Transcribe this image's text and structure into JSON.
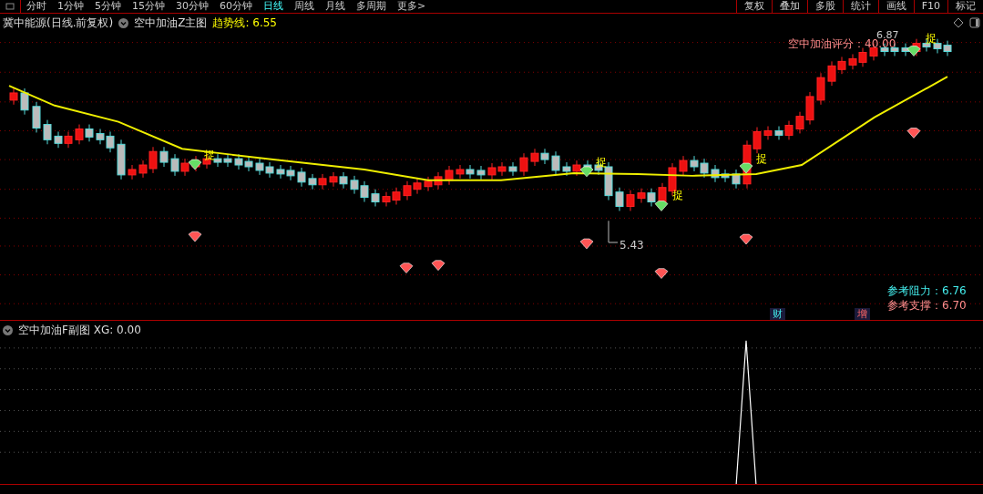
{
  "toolbar": {
    "periods": [
      {
        "label": "分时",
        "selected": false
      },
      {
        "label": "1分钟",
        "selected": false
      },
      {
        "label": "5分钟",
        "selected": false
      },
      {
        "label": "15分钟",
        "selected": false
      },
      {
        "label": "30分钟",
        "selected": false
      },
      {
        "label": "60分钟",
        "selected": false
      },
      {
        "label": "日线",
        "selected": true
      },
      {
        "label": "周线",
        "selected": false
      },
      {
        "label": "月线",
        "selected": false
      },
      {
        "label": "多周期",
        "selected": false
      },
      {
        "label": "更多>",
        "selected": false
      }
    ],
    "tools": [
      "复权",
      "叠加",
      "多股",
      "统计",
      "画线",
      "F10",
      "标记"
    ]
  },
  "main_chart": {
    "title": "冀中能源(日线.前复权)",
    "indicator": "空中加油Z主图",
    "trend_label": "趋势线: 6.55",
    "high_label": "6.87",
    "low_label": "5.43",
    "score_label": "空中加油评分：40.00",
    "signals": [
      "捉",
      "捉",
      "捉",
      "捉",
      "捉"
    ],
    "resistance": "参考阻力：6.76",
    "support": "参考支撑：6.70",
    "markers": [
      "财",
      "增"
    ]
  },
  "sub_chart": {
    "indicator": "空中加油F副图 XG: 0.00"
  }
}
